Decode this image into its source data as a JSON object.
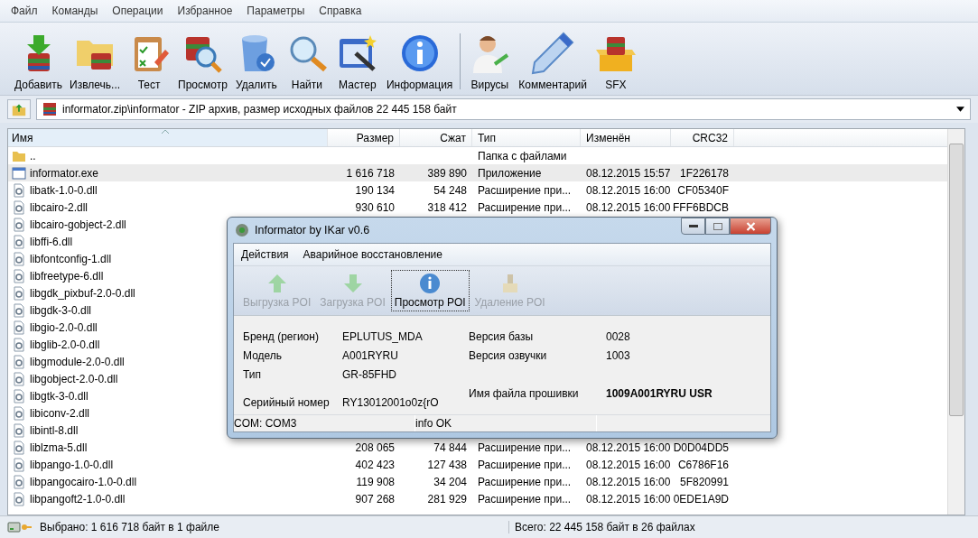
{
  "menu": [
    "Файл",
    "Команды",
    "Операции",
    "Избранное",
    "Параметры",
    "Справка"
  ],
  "toolbar": {
    "groups": [
      [
        "Добавить",
        "Извлечь...",
        "Тест",
        "Просмотр",
        "Удалить",
        "Найти",
        "Мастер",
        "Информация"
      ],
      [
        "Вирусы",
        "Комментарий",
        "SFX"
      ]
    ]
  },
  "address": "informator.zip\\informator - ZIP архив, размер исходных файлов 22 445 158 байт",
  "table": {
    "columns": [
      {
        "label": "Имя",
        "sorted": true
      },
      {
        "label": "Размер",
        "sorted": false
      },
      {
        "label": "Сжат",
        "sorted": false
      },
      {
        "label": "Тип",
        "sorted": false
      },
      {
        "label": "Изменён",
        "sorted": false
      },
      {
        "label": "CRC32",
        "sorted": false
      }
    ],
    "rows": [
      {
        "kind": "folder",
        "name": "..",
        "size": "",
        "packed": "",
        "type": "Папка с файлами",
        "modified": "",
        "crc": "",
        "selected": false
      },
      {
        "kind": "exe",
        "name": "informator.exe",
        "size": "1 616 718",
        "packed": "389 890",
        "type": "Приложение",
        "modified": "08.12.2015 15:57",
        "crc": "1F226178",
        "selected": true
      },
      {
        "kind": "dll",
        "name": "libatk-1.0-0.dll",
        "size": "190 134",
        "packed": "54 248",
        "type": "Расширение при...",
        "modified": "08.12.2015 16:00",
        "crc": "CF05340F",
        "selected": false
      },
      {
        "kind": "dll",
        "name": "libcairo-2.dll",
        "size": "930 610",
        "packed": "318 412",
        "type": "Расширение при...",
        "modified": "08.12.2015 16:00",
        "crc": "FFF6BDCB",
        "selected": false
      },
      {
        "kind": "dll",
        "name": "libcairo-gobject-2.dll",
        "selected": false
      },
      {
        "kind": "dll",
        "name": "libffi-6.dll",
        "selected": false
      },
      {
        "kind": "dll",
        "name": "libfontconfig-1.dll",
        "selected": false
      },
      {
        "kind": "dll",
        "name": "libfreetype-6.dll",
        "selected": false
      },
      {
        "kind": "dll",
        "name": "libgdk_pixbuf-2.0-0.dll",
        "selected": false
      },
      {
        "kind": "dll",
        "name": "libgdk-3-0.dll",
        "selected": false
      },
      {
        "kind": "dll",
        "name": "libgio-2.0-0.dll",
        "selected": false
      },
      {
        "kind": "dll",
        "name": "libglib-2.0-0.dll",
        "selected": false
      },
      {
        "kind": "dll",
        "name": "libgmodule-2.0-0.dll",
        "selected": false
      },
      {
        "kind": "dll",
        "name": "libgobject-2.0-0.dll",
        "selected": false
      },
      {
        "kind": "dll",
        "name": "libgtk-3-0.dll",
        "selected": false
      },
      {
        "kind": "dll",
        "name": "libiconv-2.dll",
        "selected": false
      },
      {
        "kind": "dll",
        "name": "libintl-8.dll",
        "selected": false
      },
      {
        "kind": "dll",
        "name": "liblzma-5.dll",
        "size": "208 065",
        "packed": "74 844",
        "type": "Расширение при...",
        "modified": "08.12.2015 16:00",
        "crc": "D0D04DD5",
        "selected": false
      },
      {
        "kind": "dll",
        "name": "libpango-1.0-0.dll",
        "size": "402 423",
        "packed": "127 438",
        "type": "Расширение при...",
        "modified": "08.12.2015 16:00",
        "crc": "C6786F16",
        "selected": false
      },
      {
        "kind": "dll",
        "name": "libpangocairo-1.0-0.dll",
        "size": "119 908",
        "packed": "34 204",
        "type": "Расширение при...",
        "modified": "08.12.2015 16:00",
        "crc": "5F820991",
        "selected": false
      },
      {
        "kind": "dll",
        "name": "libpangoft2-1.0-0.dll",
        "size": "907 268",
        "packed": "281 929",
        "type": "Расширение при...",
        "modified": "08.12.2015 16:00",
        "crc": "0EDE1A9D",
        "selected": false
      }
    ]
  },
  "status_bar": {
    "left": "Выбрано: 1 616 718 байт в 1 файле",
    "right": "Всего: 22 445 158 байт в 26 файлах"
  },
  "dialog": {
    "title": "Informator by IKar v0.6",
    "menu": [
      "Действия",
      "Аварийное восстановление"
    ],
    "buttons": [
      {
        "label": "Выгрузка POI",
        "disabled": true,
        "focused": false
      },
      {
        "label": "Загрузка POI",
        "disabled": true,
        "focused": false
      },
      {
        "label": "Просмотр POI",
        "disabled": false,
        "focused": true
      },
      {
        "label": "Удаление POI",
        "disabled": true,
        "focused": false
      }
    ],
    "left_fields": [
      {
        "label": "Бренд (регион)",
        "value": "EPLUTUS_MDA",
        "bold": false
      },
      {
        "label": "Модель",
        "value": "A001RYRU",
        "bold": false
      },
      {
        "label": "Тип",
        "value": "GR-85FHD",
        "bold": false
      },
      {
        "label": "Серийный номер",
        "value": "RY13012001o0z{rO",
        "bold": false
      }
    ],
    "right_fields": [
      {
        "label": "Версия базы",
        "value": "0028",
        "bold": false
      },
      {
        "label": "Версия озвучки",
        "value": "1003",
        "bold": false
      },
      {
        "label": "Имя файла прошивки",
        "value": "1009A001RYRU USR",
        "bold": true
      }
    ],
    "status": [
      "COM: COM3",
      "info OK"
    ]
  }
}
